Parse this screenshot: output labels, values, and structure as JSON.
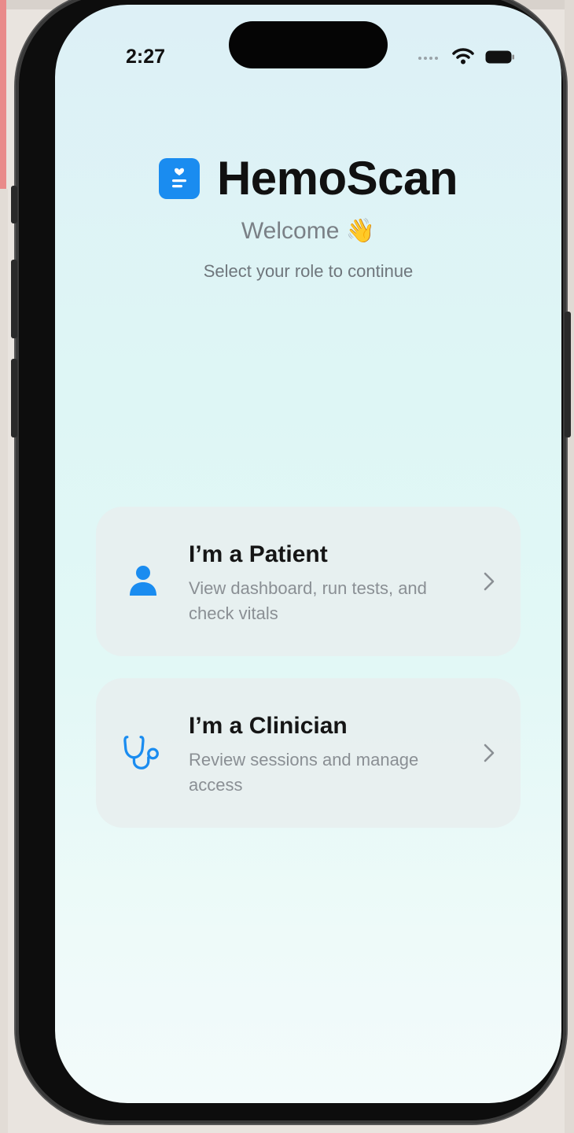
{
  "status_bar": {
    "time": "2:27",
    "icons": [
      "signal-dots-icon",
      "wifi-icon",
      "battery-icon"
    ]
  },
  "header": {
    "logo_icon": "heart-document-icon",
    "app_title": "HemoScan",
    "welcome": "Welcome 👋",
    "subtitle": "Select your role to continue"
  },
  "roles": [
    {
      "icon": "person-icon",
      "title": "I’m a Patient",
      "description": "View dashboard, run tests, and check vitals"
    },
    {
      "icon": "stethoscope-icon",
      "title": "I’m a Clinician",
      "description": "Review sessions and manage access"
    }
  ],
  "colors": {
    "accent": "#1a8cf0",
    "title_text": "#111111",
    "secondary_text": "#8a8f94",
    "card_background": "#e8eeee"
  }
}
